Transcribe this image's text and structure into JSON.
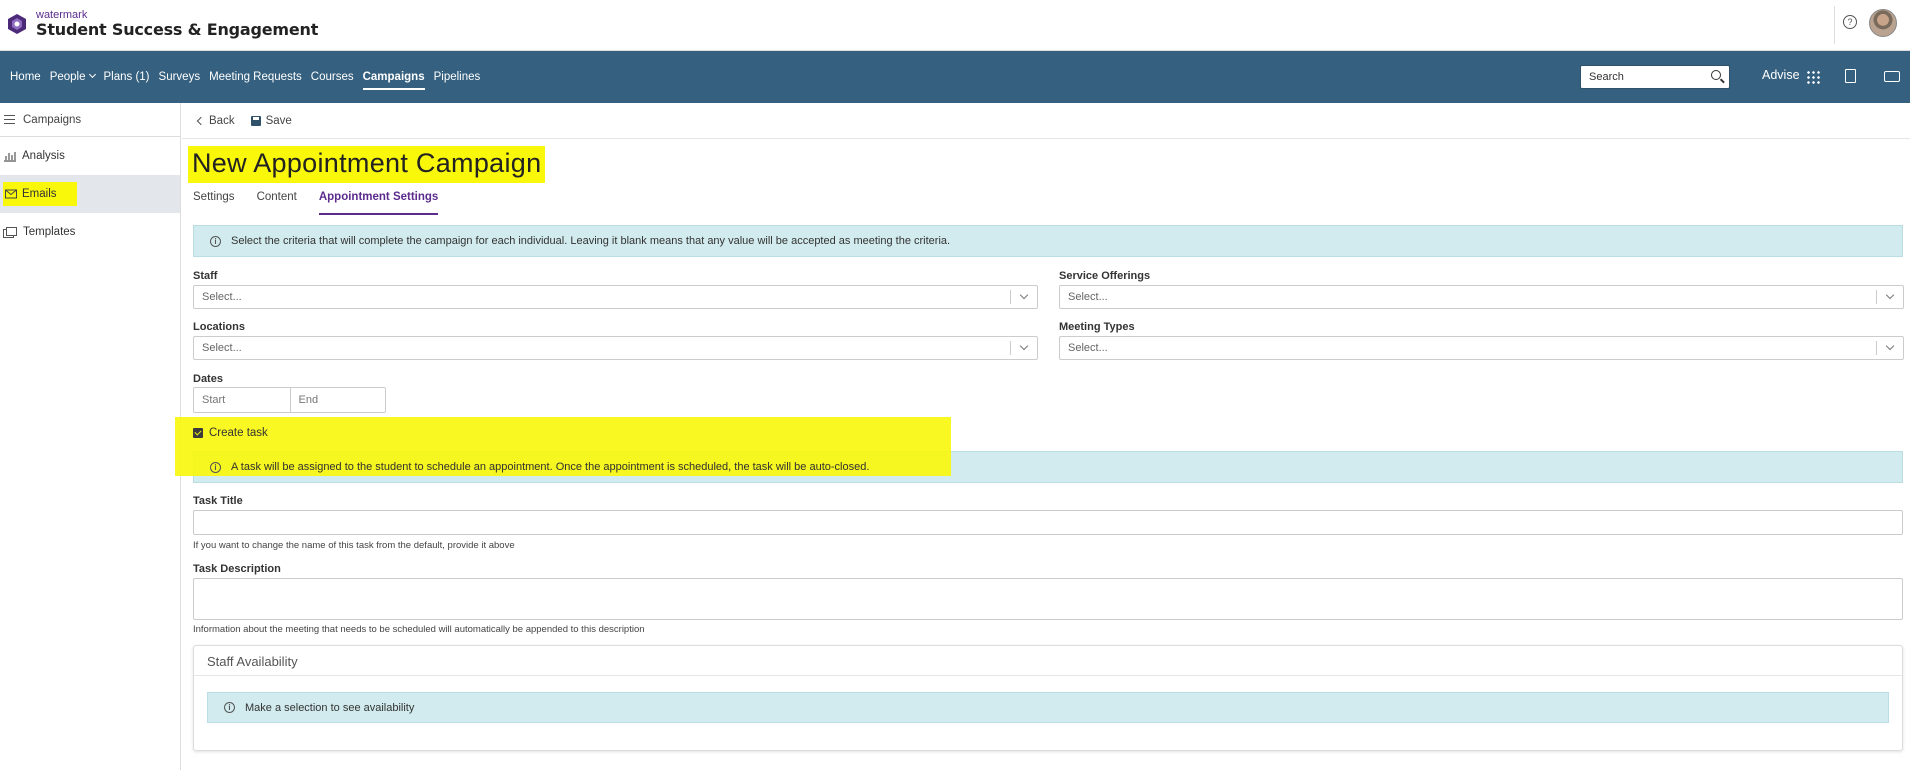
{
  "header": {
    "logo_small": "watermark",
    "logo_big": "Student Success & Engagement",
    "help_glyph": "?"
  },
  "nav": {
    "items": [
      "Home",
      "People",
      "Plans (1)",
      "Surveys",
      "Meeting Requests",
      "Courses",
      "Campaigns",
      "Pipelines"
    ],
    "active": "Campaigns",
    "search_label": "Search",
    "advise_label": "Advise"
  },
  "sidebar": {
    "header": "Campaigns",
    "items": [
      {
        "label": "Analysis",
        "icon": "bar-chart-icon"
      },
      {
        "label": "Emails",
        "icon": "envelope-icon"
      },
      {
        "label": "Templates",
        "icon": "templates-icon"
      }
    ],
    "active": "Emails"
  },
  "toolbar": {
    "back_label": "Back",
    "save_label": "Save"
  },
  "page": {
    "title": "New Appointment Campaign",
    "tabs": [
      "Settings",
      "Content",
      "Appointment Settings"
    ],
    "active_tab": "Appointment Settings",
    "criteria_info": "Select the criteria that will complete the campaign for each individual. Leaving it blank means that any value will be accepted as meeting the criteria."
  },
  "fields": {
    "staff": {
      "label": "Staff",
      "placeholder": "Select..."
    },
    "service_offerings": {
      "label": "Service Offerings",
      "placeholder": "Select..."
    },
    "locations": {
      "label": "Locations",
      "placeholder": "Select..."
    },
    "meeting_types": {
      "label": "Meeting Types",
      "placeholder": "Select..."
    },
    "dates": {
      "label": "Dates",
      "start_placeholder": "Start",
      "end_placeholder": "End"
    }
  },
  "task": {
    "checkbox_label": "Create task",
    "checked": true,
    "info": "A task will be assigned to the student to schedule an appointment. Once the appointment is scheduled, the task will be auto-closed.",
    "title_label": "Task Title",
    "title_value": "",
    "title_help": "If you want to change the name of this task from the default, provide it above",
    "description_label": "Task Description",
    "description_value": "",
    "description_help": "Information about the meeting that needs to be scheduled will automatically be appended to this description"
  },
  "availability": {
    "title": "Staff Availability",
    "info": "Make a selection to see availability"
  },
  "colors": {
    "nav_bg": "#35607f",
    "accent_purple": "#5b2c8e",
    "highlight": "#f9f70a",
    "info_bg": "#d2ebee"
  }
}
